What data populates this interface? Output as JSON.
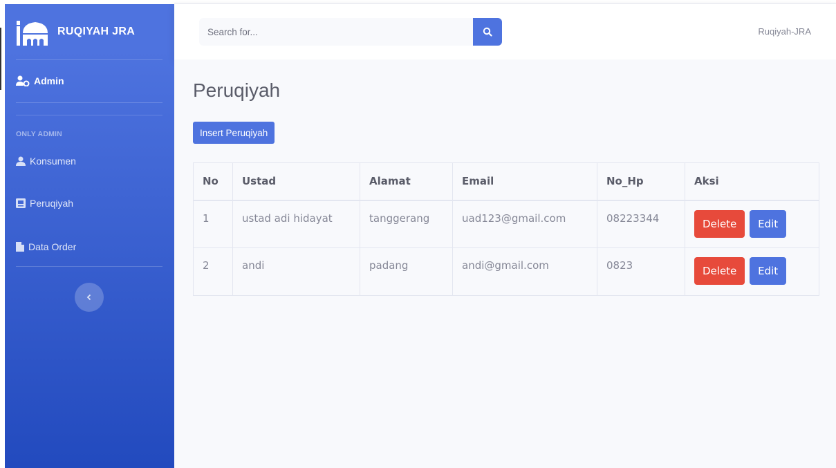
{
  "sidebar": {
    "brand": "RUQIYAH JRA",
    "admin_label": "Admin",
    "section_heading": "ONLY ADMIN",
    "items": [
      {
        "label": "Konsumen",
        "icon": "user-icon"
      },
      {
        "label": "Peruqiyah",
        "icon": "id-card-icon"
      },
      {
        "label": "Data Order",
        "icon": "file-icon"
      }
    ],
    "toggle_icon": "chevron-left-icon"
  },
  "topbar": {
    "search_placeholder": "Search for...",
    "search_icon": "search-icon",
    "user_name": "Ruqiyah-JRA"
  },
  "main": {
    "title": "Peruqiyah",
    "insert_button": "Insert Peruqiyah",
    "table": {
      "headers": [
        "No",
        "Ustad",
        "Alamat",
        "Email",
        "No_Hp",
        "Aksi"
      ],
      "rows": [
        {
          "no": "1",
          "ustad": "ustad adi hidayat",
          "alamat": "tanggerang",
          "email": "uad123@gmail.com",
          "no_hp": "08223344"
        },
        {
          "no": "2",
          "ustad": "andi",
          "alamat": "padang",
          "email": "andi@gmail.com",
          "no_hp": "0823"
        }
      ],
      "delete_label": "Delete",
      "edit_label": "Edit"
    }
  },
  "colors": {
    "primary": "#4e73df",
    "danger": "#e74a3b",
    "sidebar_gradient_end": "#224abe"
  }
}
